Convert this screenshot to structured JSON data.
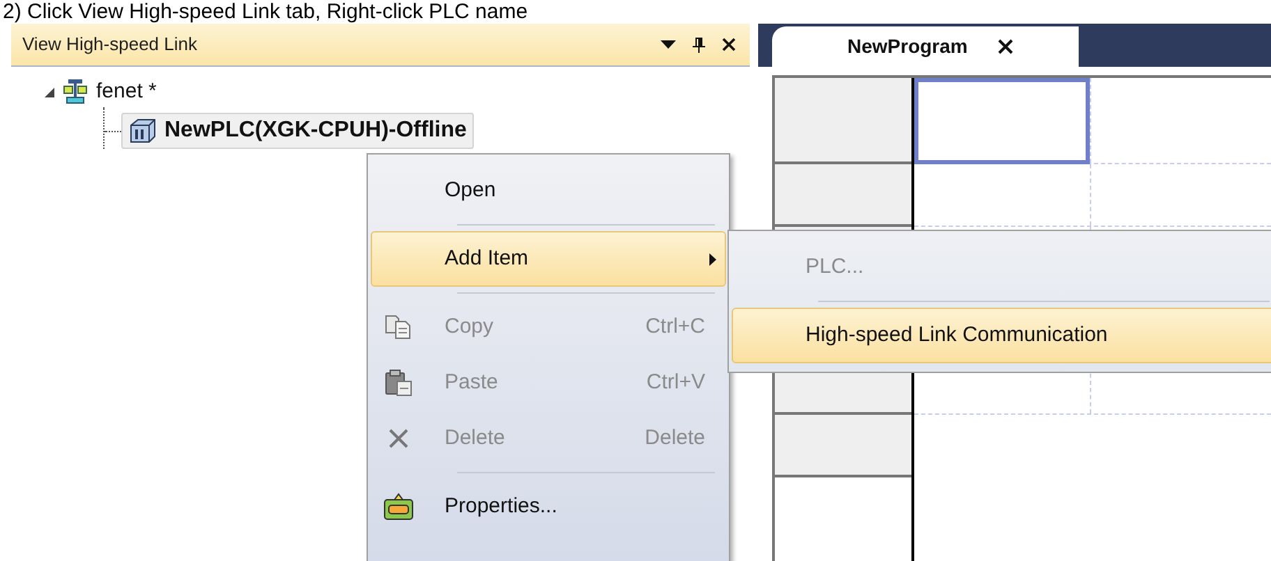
{
  "caption": "2) Click View High-speed Link tab, Right-click PLC name",
  "panel": {
    "title": "View High-speed Link"
  },
  "tree": [
    {
      "label": "fenet *",
      "expanded": true,
      "children": [
        {
          "label": "NewPLC(XGK-CPUH)-Offline",
          "selected": true
        }
      ]
    }
  ],
  "editor_tab": {
    "label": "NewProgram",
    "selected": true
  },
  "context_menu": [
    {
      "kind": "item",
      "label": "Open",
      "disabled": false,
      "selected": false
    },
    {
      "kind": "separator"
    },
    {
      "kind": "submenu",
      "label": "Add Item",
      "disabled": false,
      "selected": true
    },
    {
      "kind": "separator"
    },
    {
      "kind": "item",
      "label": "Copy",
      "shortcut": "Ctrl+C",
      "disabled": true,
      "selected": false
    },
    {
      "kind": "item",
      "label": "Paste",
      "shortcut": "Ctrl+V",
      "disabled": true,
      "selected": false
    },
    {
      "kind": "item",
      "label": "Delete",
      "shortcut": "Delete",
      "disabled": true,
      "selected": false
    },
    {
      "kind": "separator"
    },
    {
      "kind": "item",
      "label": "Properties...",
      "disabled": false,
      "selected": false
    }
  ],
  "submenu": [
    {
      "kind": "item",
      "label": "PLC...",
      "disabled": true,
      "selected": false
    },
    {
      "kind": "separator"
    },
    {
      "kind": "item",
      "label": "High-speed Link Communication",
      "disabled": false,
      "selected": true
    }
  ]
}
